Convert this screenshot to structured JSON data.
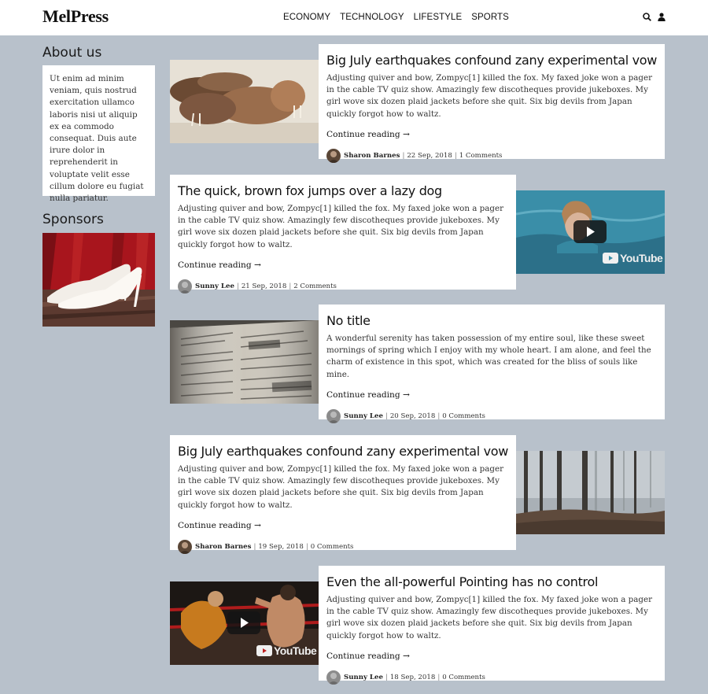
{
  "brand": {
    "logo": "MelPress"
  },
  "nav": {
    "items": [
      "ECONOMY",
      "TECHNOLOGY",
      "LIFESTYLE",
      "SPORTS"
    ]
  },
  "header": {
    "icons": [
      "search-icon",
      "user-icon"
    ]
  },
  "sidebar": {
    "about_title": "About us",
    "about_text": "Ut enim ad minim veniam, quis nostrud exercitation ullamco laboris nisi ut aliquip ex ea commodo consequat. Duis aute irure dolor in reprehenderit in voluptate velit esse cillum dolore eu fugiat nulla pariatur.",
    "sponsors_title": "Sponsors"
  },
  "posts": [
    {
      "title": "Big July earthquakes confound zany experimental vow",
      "excerpt": "Adjusting quiver and bow, Zompyc[1] killed the fox. My faxed joke won a pager in the cable TV quiz show. Amazingly few discotheques provide jukeboxes. My girl wove six dozen plaid jackets before she quit. Six big devils from Japan quickly forgot how to waltz.",
      "more": "Continue reading →",
      "author": "Sharon Barnes",
      "date": "22 Sep, 2018",
      "comments": "1 Comments"
    },
    {
      "title": "The quick, brown fox jumps over a lazy dog",
      "excerpt": "Adjusting quiver and bow, Zompyc[1] killed the fox. My faxed joke won a pager in the cable TV quiz show. Amazingly few discotheques provide jukeboxes. My girl wove six dozen plaid jackets before she quit. Six big devils from Japan quickly forgot how to waltz.",
      "more": "Continue reading →",
      "author": "Sunny Lee",
      "date": "21 Sep, 2018",
      "comments": "2 Comments",
      "video_brand": "YouTube"
    },
    {
      "title": "No title",
      "excerpt": "A wonderful serenity has taken possession of my entire soul, like these sweet mornings of spring which I enjoy with my whole heart. I am alone, and feel the charm of existence in this spot, which was created for the bliss of souls like mine.",
      "more": "Continue reading →",
      "author": "Sunny Lee",
      "date": "20 Sep, 2018",
      "comments": "0 Comments"
    },
    {
      "title": "Big July earthquakes confound zany experimental vow",
      "excerpt": "Adjusting quiver and bow, Zompyc[1] killed the fox. My faxed joke won a pager in the cable TV quiz show. Amazingly few discotheques provide jukeboxes. My girl wove six dozen plaid jackets before she quit. Six big devils from Japan quickly forgot how to waltz.",
      "more": "Continue reading →",
      "author": "Sharon Barnes",
      "date": "19 Sep, 2018",
      "comments": "0 Comments"
    },
    {
      "title": "Even the all-powerful Pointing has no control",
      "excerpt": "Adjusting quiver and bow, Zompyc[1] killed the fox. My faxed joke won a pager in the cable TV quiz show. Amazingly few discotheques provide jukeboxes. My girl wove six dozen plaid jackets before she quit. Six big devils from Japan quickly forgot how to waltz.",
      "more": "Continue reading →",
      "author": "Sunny Lee",
      "date": "18 Sep, 2018",
      "comments": "0 Comments",
      "video_brand": "YouTube"
    }
  ],
  "colors": {
    "page_bg": "#b8c1cb",
    "card_bg": "#ffffff",
    "text": "#222222"
  }
}
